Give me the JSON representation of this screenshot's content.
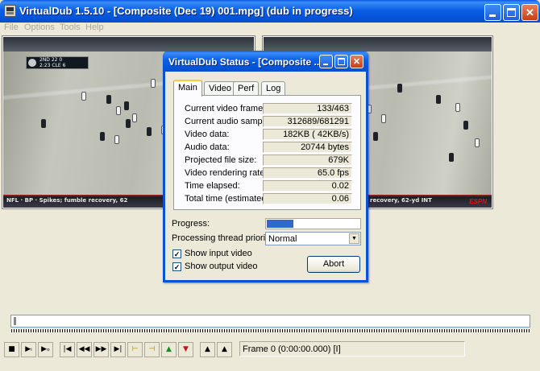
{
  "window": {
    "title": "VirtualDub 1.5.10 - [Composite (Dec 19) 001.mpg] (dub in progress)",
    "minimize": "_",
    "maximize": "□",
    "close": "✕"
  },
  "menu": [
    "File",
    "Options",
    "Tools",
    "Help"
  ],
  "video": {
    "input_ticker": "NFL · BP · Spikes; fumble recovery, 62",
    "output_ticker": "recovery, 62-yd INT",
    "logo": "ESPN",
    "scorebug_line1": "2ND  22  0",
    "scorebug_line2": "2:23  CLE  6"
  },
  "status_dialog": {
    "title": "VirtualDub Status - [Composite ...",
    "tabs": [
      "Main",
      "Video",
      "Perf",
      "Log"
    ],
    "active_tab": "Main",
    "stats": [
      {
        "label": "Current video frame:",
        "value": "133/463"
      },
      {
        "label": "Current audio sample:",
        "value": "312689/681291"
      },
      {
        "label": "Video data:",
        "value": "182KB ( 42KB/s)"
      },
      {
        "label": "Audio data:",
        "value": "20744 bytes"
      },
      {
        "label": "Projected file size:",
        "value": "679K"
      },
      {
        "label": "Video rendering rate:",
        "value": "65.0 fps"
      },
      {
        "label": "Time elapsed:",
        "value": "0.02"
      },
      {
        "label": "Total time (estimated):",
        "value": "0.06"
      }
    ],
    "progress_label": "Progress:",
    "progress_fraction": 0.29,
    "priority_label": "Processing thread priority:",
    "priority_value": "Normal",
    "show_input_video": {
      "label": "Show input video",
      "checked": true
    },
    "show_output_video": {
      "label": "Show output video",
      "checked": true
    },
    "abort_label": "Abort",
    "check_mark": "✓"
  },
  "toolbar": {
    "buttons": [
      "stop",
      "play-input",
      "play-output",
      "first-frame",
      "prev-keyframe",
      "prev-frame",
      "next-frame",
      "last-frame",
      "mark-in",
      "mark-out",
      "scene-prev",
      "scene-next",
      "jump-prev",
      "jump-next"
    ],
    "frame_status": "Frame 0 (0:00:00.000) [I]"
  }
}
